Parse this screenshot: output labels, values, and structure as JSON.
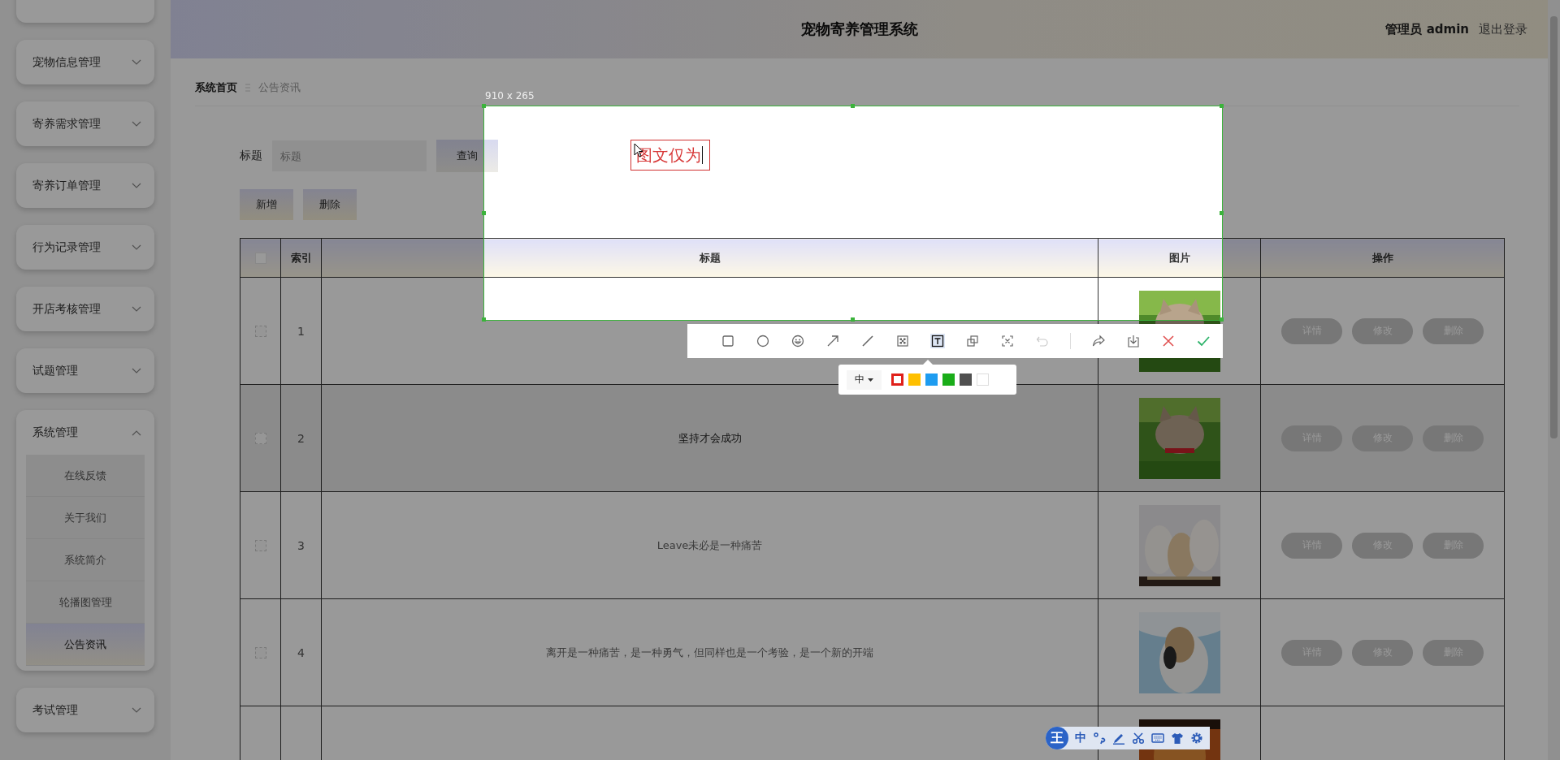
{
  "sidebar": {
    "items": [
      {
        "label": "宠物信息管理",
        "expanded": false
      },
      {
        "label": "寄养需求管理",
        "expanded": false
      },
      {
        "label": "寄养订单管理",
        "expanded": false
      },
      {
        "label": "行为记录管理",
        "expanded": false
      },
      {
        "label": "开店考核管理",
        "expanded": false
      },
      {
        "label": "试题管理",
        "expanded": false
      },
      {
        "label": "系统管理",
        "expanded": true,
        "children": [
          {
            "label": "在线反馈",
            "selected": false
          },
          {
            "label": "关于我们",
            "selected": false
          },
          {
            "label": "系统简介",
            "selected": false
          },
          {
            "label": "轮播图管理",
            "selected": false
          },
          {
            "label": "公告资讯",
            "selected": true
          }
        ]
      },
      {
        "label": "考试管理",
        "expanded": false
      }
    ]
  },
  "header": {
    "title": "宠物寄养管理系统",
    "user": "管理员 admin",
    "logout": "退出登录"
  },
  "breadcrumb": [
    "系统首页",
    "公告资讯"
  ],
  "search": {
    "label": "标题",
    "placeholder": "标题",
    "button": "查询"
  },
  "actions": [
    "新增",
    "删除"
  ],
  "table": {
    "columns": [
      "索引",
      "标题",
      "图片",
      "操作"
    ],
    "rows": [
      {
        "index": "1",
        "checked": false,
        "hovered": false,
        "picture": {
          "kind": "picture"
        },
        "actions": [
          "详情",
          "修改",
          "删除"
        ]
      },
      {
        "index": "2",
        "checked": false,
        "hovered": true,
        "title": "坚持才会成功",
        "picture": {
          "kind": "picture"
        },
        "actions": [
          "详情",
          "修改",
          "删除"
        ]
      },
      {
        "index": "3",
        "checked": false,
        "hovered": false,
        "title": "Leave未必是一种痛苦",
        "picture": {
          "kind": "picture"
        },
        "actions": [
          "详情",
          "修改",
          "删除"
        ]
      },
      {
        "index": "4",
        "checked": false,
        "hovered": false,
        "title": "离开是一种痛苦，是一种勇气，但同样也是一个考验，是一个新的开端",
        "picture": {
          "kind": "picture"
        },
        "actions": [
          "详情",
          "修改",
          "删除"
        ]
      },
      {
        "hovered": false,
        "picture": {
          "kind": "picture"
        }
      }
    ],
    "select_all": {
      "checked": false
    }
  },
  "capture": {
    "size": "910 x 265",
    "annotation": "图文仅为",
    "tools": [
      {
        "kind": "rectangle",
        "selected": false,
        "disabled": false
      },
      {
        "kind": "ellipse",
        "selected": false,
        "disabled": false
      },
      {
        "kind": "emoji",
        "selected": false,
        "disabled": false
      },
      {
        "kind": "arrow",
        "selected": false,
        "disabled": false
      },
      {
        "kind": "pen",
        "selected": false,
        "disabled": false
      },
      {
        "kind": "mosaic",
        "selected": false,
        "disabled": false
      },
      {
        "kind": "text",
        "selected": true,
        "disabled": false
      },
      {
        "kind": "pin",
        "selected": false,
        "disabled": false
      },
      {
        "kind": "ocr",
        "selected": false,
        "disabled": false
      },
      {
        "kind": "undo",
        "selected": false,
        "disabled": true
      },
      {
        "kind": "share",
        "selected": false,
        "disabled": false
      },
      {
        "kind": "save",
        "selected": false,
        "disabled": false
      },
      {
        "kind": "cancel",
        "selected": false,
        "disabled": false
      },
      {
        "kind": "confirm",
        "selected": false,
        "disabled": false
      }
    ],
    "font_size": "中",
    "colors": [
      {
        "color": "#e0201a",
        "selected": true
      },
      {
        "color": "#ffc000",
        "selected": false
      },
      {
        "color": "#1e9cf0",
        "selected": false
      },
      {
        "color": "#1aad19",
        "selected": false
      },
      {
        "color": "#505050",
        "selected": false
      },
      {
        "color": "#ffffff",
        "selected": false
      }
    ]
  },
  "ime": {
    "logo": "王",
    "mode": "中"
  }
}
